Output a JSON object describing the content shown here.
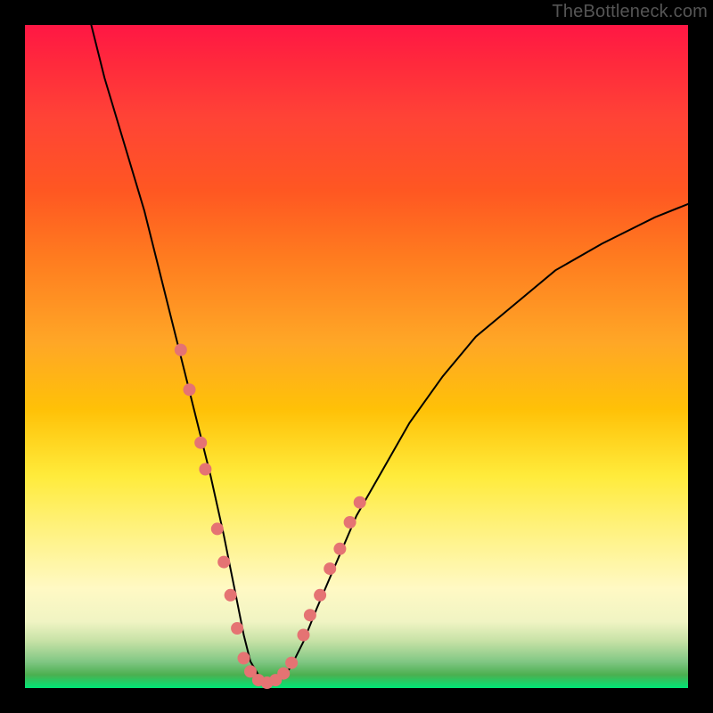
{
  "watermark": "TheBottleneck.com",
  "frame": {
    "outer_color": "#000000",
    "inner_left": 28,
    "inner_top": 28,
    "inner_width": 744,
    "inner_height": 744
  },
  "gradient_stops": [
    {
      "pos": 0.0,
      "color": "#ff1744"
    },
    {
      "pos": 0.06,
      "color": "#ff2a3c"
    },
    {
      "pos": 0.14,
      "color": "#ff4336"
    },
    {
      "pos": 0.25,
      "color": "#ff5722"
    },
    {
      "pos": 0.35,
      "color": "#ff7b1f"
    },
    {
      "pos": 0.48,
      "color": "#ffa726"
    },
    {
      "pos": 0.58,
      "color": "#ffc107"
    },
    {
      "pos": 0.68,
      "color": "#ffeb3b"
    },
    {
      "pos": 0.75,
      "color": "#fff176"
    },
    {
      "pos": 0.8,
      "color": "#fff59d"
    },
    {
      "pos": 0.85,
      "color": "#fff9c4"
    },
    {
      "pos": 0.9,
      "color": "#f0f4c3"
    },
    {
      "pos": 0.93,
      "color": "#c5e1a5"
    },
    {
      "pos": 0.96,
      "color": "#81c784"
    },
    {
      "pos": 0.98,
      "color": "#4caf50"
    },
    {
      "pos": 1.0,
      "color": "#00e676"
    }
  ],
  "chart_data": {
    "type": "line",
    "title": "",
    "xlabel": "",
    "ylabel": "",
    "xlim": [
      0,
      100
    ],
    "ylim": [
      0,
      100
    ],
    "grid": false,
    "legend_position": "none",
    "series": [
      {
        "name": "bottleneck_curve",
        "color": "#000000",
        "stroke_width": 2,
        "x": [
          10,
          12,
          15,
          18,
          20,
          22,
          24,
          26,
          28,
          30,
          31,
          32,
          33,
          34,
          35.5,
          37,
          38.5,
          40,
          42,
          44,
          47,
          50,
          54,
          58,
          63,
          68,
          74,
          80,
          87,
          95,
          100
        ],
        "y": [
          100,
          92,
          82,
          72,
          64,
          56,
          48,
          40,
          32,
          23,
          18,
          13,
          8,
          4,
          1.5,
          0.8,
          1.5,
          3,
          7,
          12,
          19,
          26,
          33,
          40,
          47,
          53,
          58,
          63,
          67,
          71,
          73
        ]
      }
    ],
    "markers": {
      "name": "highlight_dots",
      "color": "#e57373",
      "radius_px": 7,
      "points_left_branch": [
        {
          "x": 23.5,
          "y": 51
        },
        {
          "x": 24.8,
          "y": 45
        },
        {
          "x": 26.5,
          "y": 37
        },
        {
          "x": 27.2,
          "y": 33
        },
        {
          "x": 29.0,
          "y": 24
        },
        {
          "x": 30.0,
          "y": 19
        },
        {
          "x": 31.0,
          "y": 14
        },
        {
          "x": 32.0,
          "y": 9
        }
      ],
      "points_bottom": [
        {
          "x": 33.0,
          "y": 4.5
        },
        {
          "x": 34.0,
          "y": 2.5
        },
        {
          "x": 35.2,
          "y": 1.2
        },
        {
          "x": 36.5,
          "y": 0.8
        },
        {
          "x": 37.8,
          "y": 1.2
        },
        {
          "x": 39.0,
          "y": 2.2
        },
        {
          "x": 40.2,
          "y": 3.8
        }
      ],
      "points_right_branch": [
        {
          "x": 42.0,
          "y": 8
        },
        {
          "x": 43.0,
          "y": 11
        },
        {
          "x": 44.5,
          "y": 14
        },
        {
          "x": 46.0,
          "y": 18
        },
        {
          "x": 47.5,
          "y": 21
        },
        {
          "x": 49.0,
          "y": 25
        },
        {
          "x": 50.5,
          "y": 28
        }
      ]
    }
  }
}
